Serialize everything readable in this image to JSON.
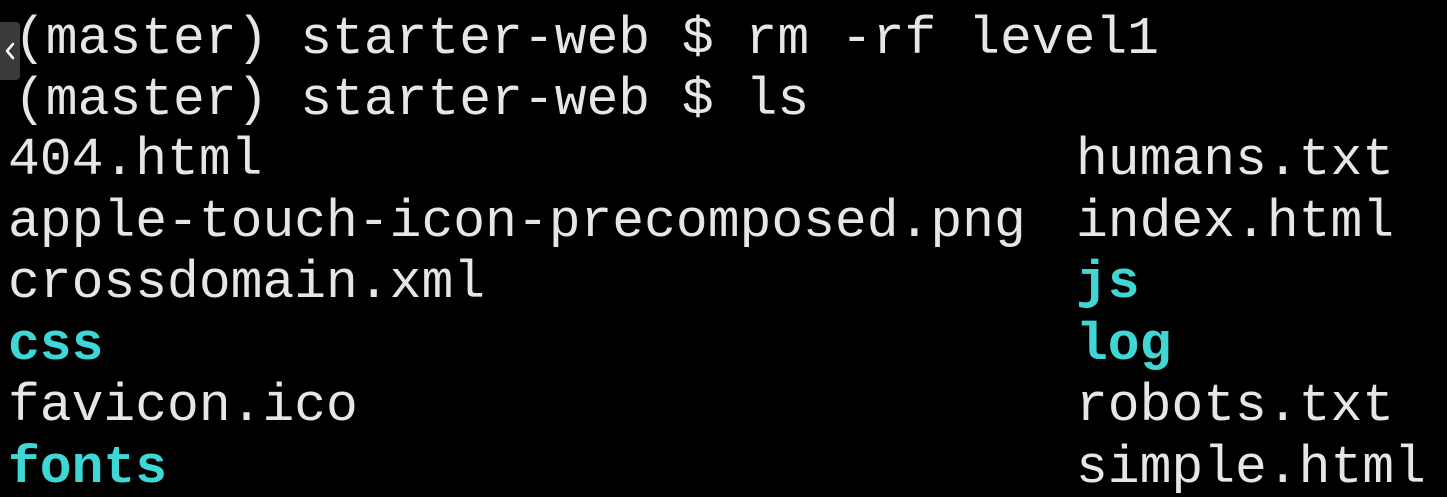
{
  "terminal": {
    "background": "#000000",
    "text_color": "#e6e6e6",
    "directory_color": "#3fd6d6",
    "commands": [
      "(master) starter-web $ rm -rf level1",
      "(master) starter-web $ ls"
    ],
    "listing": {
      "left": [
        {
          "name": "404.html",
          "type": "file"
        },
        {
          "name": "apple-touch-icon-precomposed.png",
          "type": "file"
        },
        {
          "name": "crossdomain.xml",
          "type": "file"
        },
        {
          "name": "css",
          "type": "directory"
        },
        {
          "name": "favicon.ico",
          "type": "file"
        },
        {
          "name": "fonts",
          "type": "directory"
        }
      ],
      "right": [
        {
          "name": "humans.txt",
          "type": "file"
        },
        {
          "name": "index.html",
          "type": "file"
        },
        {
          "name": "js",
          "type": "directory"
        },
        {
          "name": "log",
          "type": "directory"
        },
        {
          "name": "robots.txt",
          "type": "file"
        },
        {
          "name": "simple.html",
          "type": "file"
        }
      ]
    }
  },
  "overlay": {
    "back_icon": "chevron-left-icon"
  }
}
